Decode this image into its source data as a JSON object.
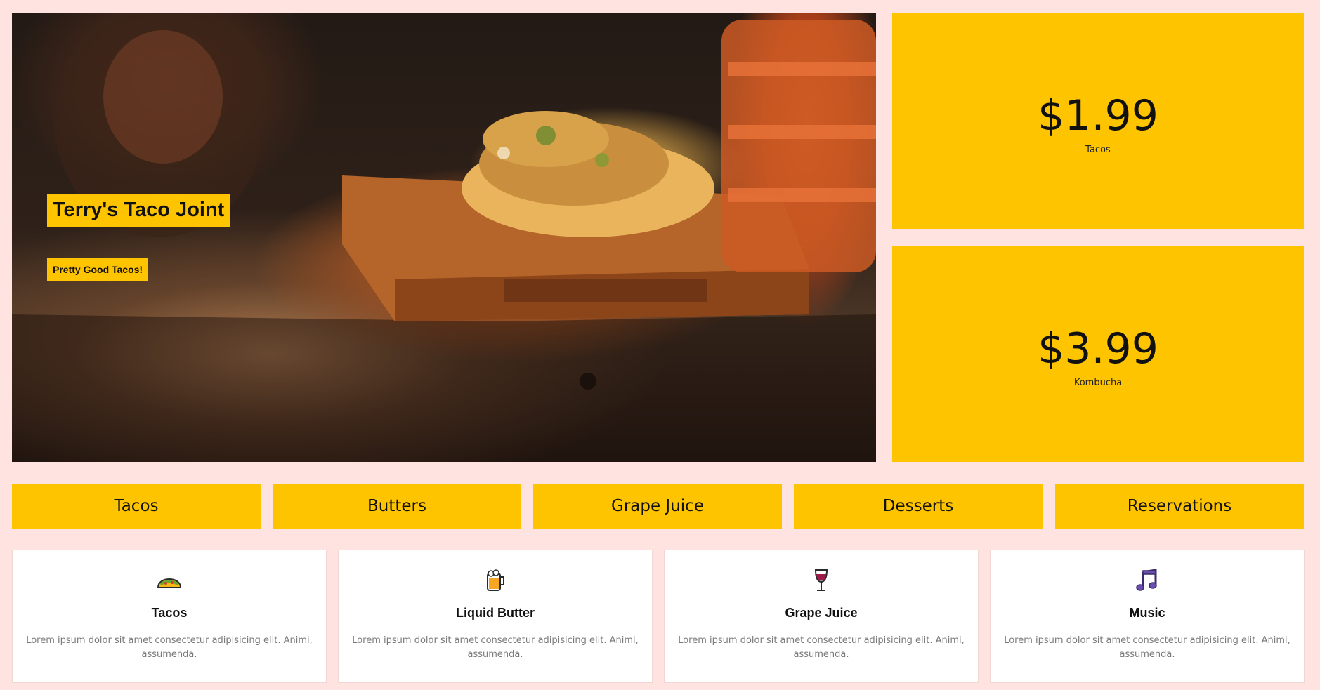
{
  "hero": {
    "title": "Terry's Taco Joint",
    "subtitle": "Pretty Good Tacos!",
    "image": "tacos-on-wooden-board-photo"
  },
  "prices": [
    {
      "value": "$1.99",
      "label": "Tacos"
    },
    {
      "value": "$3.99",
      "label": "Kombucha"
    }
  ],
  "nav": {
    "items": [
      "Tacos",
      "Butters",
      "Grape Juice",
      "Desserts",
      "Reservations"
    ]
  },
  "features": [
    {
      "icon": "taco-icon",
      "title": "Tacos",
      "description": "Lorem ipsum dolor sit amet consectetur adipisicing elit. Animi, assumenda."
    },
    {
      "icon": "beer-mug-icon",
      "title": "Liquid Butter",
      "description": "Lorem ipsum dolor sit amet consectetur adipisicing elit. Animi, assumenda."
    },
    {
      "icon": "wine-glass-icon",
      "title": "Grape Juice",
      "description": "Lorem ipsum dolor sit amet consectetur adipisicing elit. Animi, assumenda."
    },
    {
      "icon": "music-notes-icon",
      "title": "Music",
      "description": "Lorem ipsum dolor sit amet consectetur adipisicing elit. Animi, assumenda."
    }
  ],
  "colors": {
    "accent": "#ffc400",
    "background": "#ffe3e1",
    "card": "#ffffff",
    "muted_text": "#7a7a7a"
  }
}
